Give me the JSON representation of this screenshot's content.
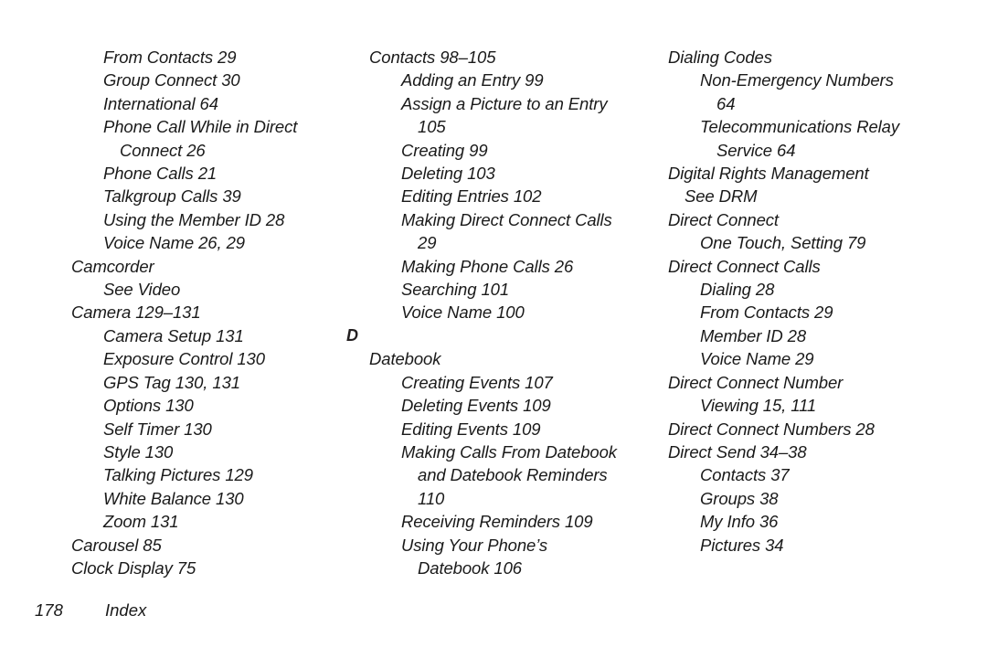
{
  "page": {
    "footer": {
      "page_number": "178",
      "label": "Index"
    }
  },
  "columns": [
    {
      "id": "column-1",
      "entries": [
        {
          "level": 1,
          "lines": [
            "From Contacts 29"
          ]
        },
        {
          "level": 1,
          "lines": [
            "Group Connect 30"
          ]
        },
        {
          "level": 1,
          "lines": [
            "International 64"
          ]
        },
        {
          "level": 1,
          "lines": [
            "Phone Call While in Direct",
            "Connect 26"
          ]
        },
        {
          "level": 1,
          "lines": [
            "Phone Calls 21"
          ]
        },
        {
          "level": 1,
          "lines": [
            "Talkgroup Calls 39"
          ]
        },
        {
          "level": 1,
          "lines": [
            "Using the Member ID 28"
          ]
        },
        {
          "level": 1,
          "lines": [
            "Voice Name 26, 29"
          ]
        },
        {
          "level": 0,
          "lines": [
            "Camcorder"
          ]
        },
        {
          "level": 1,
          "lines": [
            "See Video"
          ]
        },
        {
          "level": 0,
          "lines": [
            "Camera 129–131"
          ]
        },
        {
          "level": 1,
          "lines": [
            "Camera Setup 131"
          ]
        },
        {
          "level": 1,
          "lines": [
            "Exposure Control 130"
          ]
        },
        {
          "level": 1,
          "lines": [
            "GPS Tag 130, 131"
          ]
        },
        {
          "level": 1,
          "lines": [
            "Options 130"
          ]
        },
        {
          "level": 1,
          "lines": [
            "Self Timer 130"
          ]
        },
        {
          "level": 1,
          "lines": [
            "Style 130"
          ]
        },
        {
          "level": 1,
          "lines": [
            "Talking Pictures 129"
          ]
        },
        {
          "level": 1,
          "lines": [
            "White Balance 130"
          ]
        },
        {
          "level": 1,
          "lines": [
            "Zoom 131"
          ]
        },
        {
          "level": 0,
          "lines": [
            "Carousel 85"
          ]
        },
        {
          "level": 0,
          "lines": [
            "Clock Display 75"
          ]
        }
      ]
    },
    {
      "id": "column-2",
      "entries": [
        {
          "level": 0,
          "lines": [
            "Contacts 98–105"
          ]
        },
        {
          "level": 1,
          "lines": [
            "Adding an Entry 99"
          ]
        },
        {
          "level": 1,
          "lines": [
            "Assign a Picture to an Entry",
            "105"
          ]
        },
        {
          "level": 1,
          "lines": [
            "Creating 99"
          ]
        },
        {
          "level": 1,
          "lines": [
            "Deleting 103"
          ]
        },
        {
          "level": 1,
          "lines": [
            "Editing Entries 102"
          ]
        },
        {
          "level": 1,
          "lines": [
            "Making Direct Connect Calls",
            "29"
          ]
        },
        {
          "level": 1,
          "lines": [
            "Making Phone Calls 26"
          ]
        },
        {
          "level": 1,
          "lines": [
            "Searching 101"
          ]
        },
        {
          "level": 1,
          "lines": [
            "Voice Name 100"
          ]
        },
        {
          "section_letter": "D"
        },
        {
          "level": 0,
          "lines": [
            "Datebook"
          ]
        },
        {
          "level": 1,
          "lines": [
            "Creating Events 107"
          ]
        },
        {
          "level": 1,
          "lines": [
            "Deleting Events 109"
          ]
        },
        {
          "level": 1,
          "lines": [
            "Editing Events 109"
          ]
        },
        {
          "level": 1,
          "lines": [
            "Making Calls From Datebook",
            "and Datebook Reminders",
            "110"
          ]
        },
        {
          "level": 1,
          "lines": [
            "Receiving Reminders 109"
          ]
        },
        {
          "level": 1,
          "lines": [
            "Using Your Phone’s",
            "Datebook 106"
          ]
        }
      ]
    },
    {
      "id": "column-3",
      "entries": [
        {
          "level": 0,
          "lines": [
            "Dialing Codes"
          ]
        },
        {
          "level": 1,
          "lines": [
            "Non-Emergency Numbers",
            "64"
          ]
        },
        {
          "level": 1,
          "lines": [
            "Telecommunications Relay",
            "Service 64"
          ]
        },
        {
          "level": 0,
          "lines": [
            "Digital Rights Management",
            "See DRM"
          ]
        },
        {
          "level": 0,
          "lines": [
            "Direct Connect"
          ]
        },
        {
          "level": 1,
          "lines": [
            "One Touch, Setting 79"
          ]
        },
        {
          "level": 0,
          "lines": [
            "Direct Connect Calls"
          ]
        },
        {
          "level": 1,
          "lines": [
            "Dialing 28"
          ]
        },
        {
          "level": 1,
          "lines": [
            "From Contacts 29"
          ]
        },
        {
          "level": 1,
          "lines": [
            "Member ID 28"
          ]
        },
        {
          "level": 1,
          "lines": [
            "Voice Name 29"
          ]
        },
        {
          "level": 0,
          "lines": [
            "Direct Connect Number"
          ]
        },
        {
          "level": 1,
          "lines": [
            "Viewing 15, 111"
          ]
        },
        {
          "level": 0,
          "lines": [
            "Direct Connect Numbers 28"
          ]
        },
        {
          "level": 0,
          "lines": [
            "Direct Send 34–38"
          ]
        },
        {
          "level": 1,
          "lines": [
            "Contacts 37"
          ]
        },
        {
          "level": 1,
          "lines": [
            "Groups 38"
          ]
        },
        {
          "level": 1,
          "lines": [
            "My Info 36"
          ]
        },
        {
          "level": 1,
          "lines": [
            "Pictures 34"
          ]
        }
      ]
    }
  ]
}
